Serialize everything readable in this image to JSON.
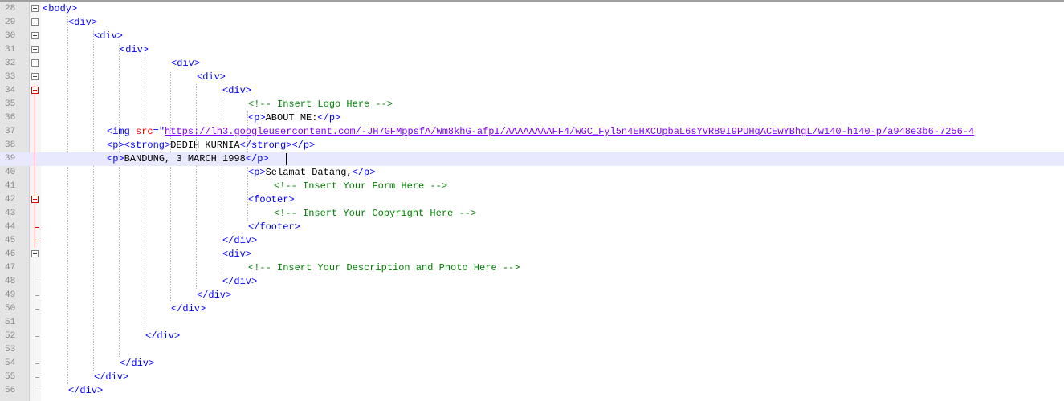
{
  "editor": {
    "lines": [
      {
        "num": "28",
        "indent": 0,
        "tokens": [
          {
            "t": "tag",
            "v": "<body>"
          }
        ],
        "fold": "box"
      },
      {
        "num": "29",
        "indent": 1,
        "tokens": [
          {
            "t": "tag",
            "v": "<div>"
          }
        ],
        "fold": "box"
      },
      {
        "num": "30",
        "indent": 2,
        "tokens": [
          {
            "t": "tag",
            "v": "<div>"
          }
        ],
        "fold": "box"
      },
      {
        "num": "31",
        "indent": 3,
        "tokens": [
          {
            "t": "tag",
            "v": "<div>"
          }
        ],
        "fold": "box"
      },
      {
        "num": "32",
        "indent": 5,
        "tokens": [
          {
            "t": "tag",
            "v": "<div>"
          }
        ],
        "fold": "box"
      },
      {
        "num": "33",
        "indent": 6,
        "tokens": [
          {
            "t": "tag",
            "v": "<div>"
          }
        ],
        "fold": "box"
      },
      {
        "num": "34",
        "indent": 7,
        "tokens": [
          {
            "t": "tag",
            "v": "<div>"
          }
        ],
        "fold": "box-red"
      },
      {
        "num": "35",
        "indent": 8,
        "tokens": [
          {
            "t": "cmt",
            "v": "<!-- Insert Logo Here -->"
          }
        ],
        "fold": "line-red"
      },
      {
        "num": "36",
        "indent": 8,
        "tokens": [
          {
            "t": "tag",
            "v": "<p>"
          },
          {
            "t": "txt",
            "v": "ABOUT ME:"
          },
          {
            "t": "tag",
            "v": "</p>"
          }
        ],
        "fold": "line-red"
      },
      {
        "num": "37",
        "indent": 2.5,
        "tokens": [
          {
            "t": "tag",
            "v": "<img "
          },
          {
            "t": "attr",
            "v": "src"
          },
          {
            "t": "tag",
            "v": "=\""
          },
          {
            "t": "val",
            "v": "https://lh3.googleusercontent.com/-JH7GFMppsfA/Wm8khG-afpI/AAAAAAAAFF4/wGC_Fyl5n4EHXCUpbaL6sYVR89I9PUHqACEwYBhgL/w140-h140-p/a948e3b6-7256-4"
          }
        ],
        "fold": "line-red"
      },
      {
        "num": "38",
        "indent": 2.5,
        "tokens": [
          {
            "t": "tag",
            "v": "<p><strong>"
          },
          {
            "t": "txt",
            "v": "DEDIH KURNIA"
          },
          {
            "t": "tag",
            "v": "</strong></p>"
          }
        ],
        "fold": "line-red"
      },
      {
        "num": "39",
        "indent": 2.5,
        "tokens": [
          {
            "t": "tag",
            "v": "<p>"
          },
          {
            "t": "txt",
            "v": "BANDUNG, 3 MARCH 1998"
          },
          {
            "t": "tag",
            "v": "</p>"
          }
        ],
        "fold": "line-red",
        "current": true
      },
      {
        "num": "40",
        "indent": 8,
        "tokens": [
          {
            "t": "tag",
            "v": "<p>"
          },
          {
            "t": "txt",
            "v": "Selamat Datang,"
          },
          {
            "t": "tag",
            "v": "</p>"
          }
        ],
        "fold": "line-red"
      },
      {
        "num": "41",
        "indent": 9,
        "tokens": [
          {
            "t": "cmt",
            "v": "<!-- Insert Your Form Here -->"
          }
        ],
        "fold": "line-red"
      },
      {
        "num": "42",
        "indent": 8,
        "tokens": [
          {
            "t": "tag",
            "v": "<footer>"
          }
        ],
        "fold": "box-red"
      },
      {
        "num": "43",
        "indent": 9,
        "tokens": [
          {
            "t": "cmt",
            "v": "<!-- Insert Your Copyright Here -->"
          }
        ],
        "fold": "line-red"
      },
      {
        "num": "44",
        "indent": 8,
        "tokens": [
          {
            "t": "tag",
            "v": "</footer>"
          }
        ],
        "fold": "end-red"
      },
      {
        "num": "45",
        "indent": 7,
        "tokens": [
          {
            "t": "tag",
            "v": "</div>"
          }
        ],
        "fold": "end-red"
      },
      {
        "num": "46",
        "indent": 7,
        "tokens": [
          {
            "t": "tag",
            "v": "<div>"
          }
        ],
        "fold": "box"
      },
      {
        "num": "47",
        "indent": 8,
        "tokens": [
          {
            "t": "cmt",
            "v": "<!-- Insert Your Description and Photo Here -->"
          }
        ],
        "fold": "line"
      },
      {
        "num": "48",
        "indent": 7,
        "tokens": [
          {
            "t": "tag",
            "v": "</div>"
          }
        ],
        "fold": "end"
      },
      {
        "num": "49",
        "indent": 6,
        "tokens": [
          {
            "t": "tag",
            "v": "</div>"
          }
        ],
        "fold": "end"
      },
      {
        "num": "50",
        "indent": 5,
        "tokens": [
          {
            "t": "tag",
            "v": "</div>"
          }
        ],
        "fold": "end"
      },
      {
        "num": "51",
        "indent": 0,
        "tokens": [],
        "fold": "line"
      },
      {
        "num": "52",
        "indent": 4,
        "tokens": [
          {
            "t": "tag",
            "v": "</div>"
          }
        ],
        "fold": "end"
      },
      {
        "num": "53",
        "indent": 0,
        "tokens": [],
        "fold": "line"
      },
      {
        "num": "54",
        "indent": 3,
        "tokens": [
          {
            "t": "tag",
            "v": "</div>"
          }
        ],
        "fold": "end"
      },
      {
        "num": "55",
        "indent": 2,
        "tokens": [
          {
            "t": "tag",
            "v": "</div>"
          }
        ],
        "fold": "end"
      },
      {
        "num": "56",
        "indent": 1,
        "tokens": [
          {
            "t": "tag",
            "v": "</div>"
          }
        ],
        "fold": "end"
      }
    ]
  }
}
